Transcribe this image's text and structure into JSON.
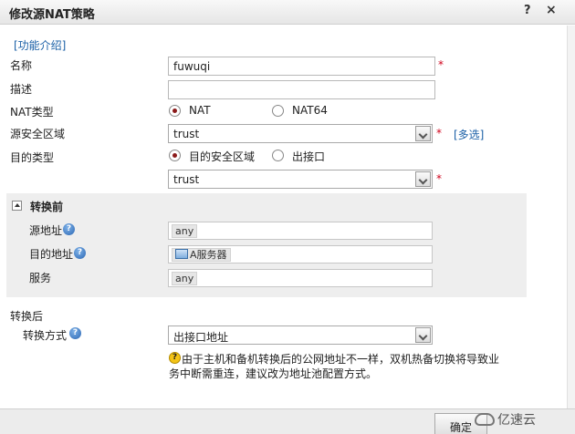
{
  "dialog": {
    "title": "修改源NAT策略",
    "help_label": "?",
    "close_label": "×"
  },
  "intro_link": "[功能介绍]",
  "fields": {
    "name_label": "名称",
    "name_value": "fuwuqi",
    "desc_label": "描述",
    "desc_value": "",
    "nat_type_label": "NAT类型",
    "nat_option_nat": "NAT",
    "nat_option_nat64": "NAT64",
    "src_zone_label": "源安全区域",
    "src_zone_value": "trust",
    "multi_select_link": "[多选]",
    "dest_type_label": "目的类型",
    "dest_option_zone": "目的安全区域",
    "dest_option_iface": "出接口",
    "dest_zone_value": "trust",
    "required_mark": "*"
  },
  "before": {
    "header": "转换前",
    "src_addr_label": "源地址",
    "src_addr_value": "any",
    "dst_addr_label": "目的地址",
    "dst_addr_value": "A服务器",
    "service_label": "服务",
    "service_value": "any"
  },
  "after": {
    "header": "转换后",
    "method_label": "转换方式",
    "method_value": "出接口地址",
    "note_line1": "由于主机和备机转换后的公网地址不一样，双机热备切换将导致业",
    "note_line2": "务中断需重连，建议改为地址池配置方式。"
  },
  "footer": {
    "ok_label": "确定"
  },
  "watermark": "亿速云"
}
